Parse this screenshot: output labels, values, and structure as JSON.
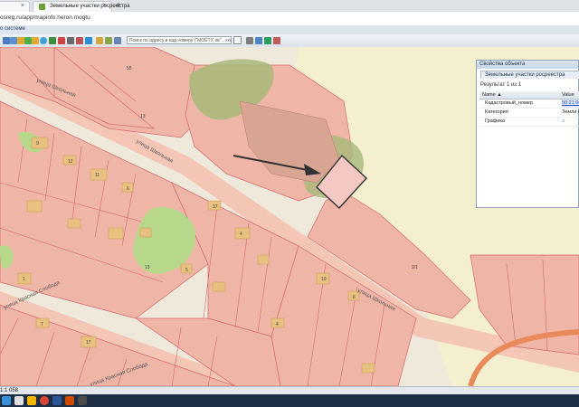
{
  "browser": {
    "tab_title": "Земельные участки росреестра",
    "close_glyph": "×",
    "new_tab_glyph": "+",
    "address": "osreg.ru/app/mapinfo.heron.mogtu",
    "bookmark_text": "о системе"
  },
  "toolbar": {
    "search_placeholder": "Поиск по адресу и кад номеру (\"МОЕТУ, кв\" , «кад_п",
    "icons": [
      "back-icon",
      "forward-icon",
      "zoom-in-icon",
      "zoom-out-icon",
      "pan-icon",
      "globe-icon",
      "refresh-icon",
      "home-icon",
      "measure-icon",
      "select-icon",
      "info-icon",
      "layers-icon",
      "print-icon",
      "draw-icon",
      "area-icon",
      "identify-icon",
      "edit-icon",
      "clear-icon"
    ]
  },
  "map": {
    "street_labels": [
      "улица Школьная",
      "улица Школьная",
      "улица Школьная",
      "улица Красная Слобода",
      "улица Красная Слобода"
    ],
    "parcel_numbers": [
      "55",
      "13",
      "9",
      "12",
      "11",
      "6",
      "37",
      "13",
      "5",
      "4",
      "10",
      "6",
      "1",
      "7",
      "17",
      "4",
      "2/1"
    ],
    "colors": {
      "background": "#efe9dc",
      "parcel": "#efb6a8",
      "parcel_border": "#d7666a",
      "building": "#e8c07f",
      "green": "#b7d88a",
      "road": "#f4c6b6",
      "highlight": "#f4c9c3"
    }
  },
  "panel": {
    "header": "Свойства объекта",
    "tab": "Земельные участки росреестра",
    "result": "Результат 1 из 1",
    "columns": [
      "Name ▲",
      "Value"
    ],
    "rows": [
      {
        "name": "Кадастровый_номер",
        "value": "50:21:00"
      },
      {
        "name": "Категория",
        "value": "Земли н"
      },
      {
        "name": "Графика",
        "value": ""
      }
    ]
  },
  "status": {
    "scale": "1:1 058"
  }
}
